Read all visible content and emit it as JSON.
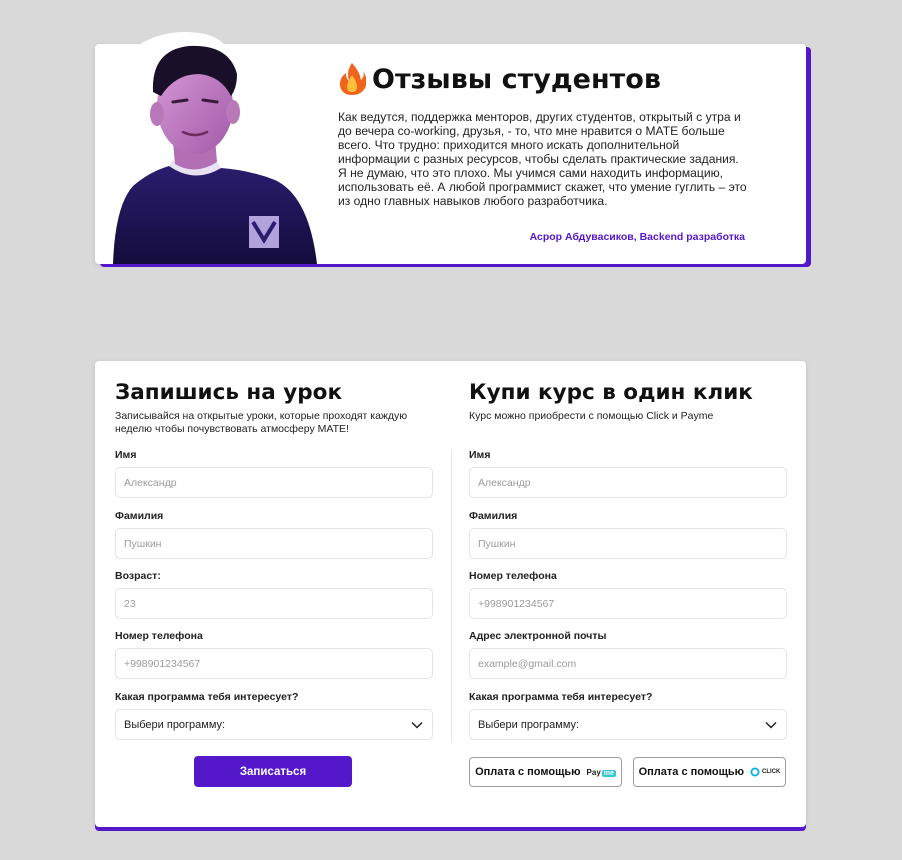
{
  "review": {
    "title": "Отзывы студентов",
    "text": "Как ведутся, поддержка менторов, других студентов, открытый с утра и до вечера co-working, друзья, - то, что мне нравится о MATE больше всего. Что трудно: приходится много искать дополнительной информации с разных ресурсов, чтобы сделать практические задания. Я не думаю, что это плохо. Мы учимся сами находить информацию, использовать её. А любой программист скажет, что умение гуглить – это из одно главных навыков любого разработчика.",
    "author": "Асрор Абдувасиков, Backend разработка",
    "emoji_icon": "fire-icon"
  },
  "lesson_form": {
    "title": "Запишись на урок",
    "subtitle": "Записывайся на открытые уроки, которые проходят каждую неделю чтобы почувствовать атмосферу MATE!",
    "fields": [
      {
        "label": "Имя",
        "placeholder": "Александр"
      },
      {
        "label": "Фамилия",
        "placeholder": "Пушкин"
      },
      {
        "label": "Возраст:",
        "placeholder": "23"
      },
      {
        "label": "Номер телефона",
        "placeholder": "+998901234567"
      },
      {
        "label": "Какая программа тебя интересует?",
        "value": "Выбери программу:"
      }
    ],
    "submit_label": "Записаться"
  },
  "buy_form": {
    "title": "Купи курс в один клик",
    "subtitle": "Курс можно приобрести с помощью Click и Payme",
    "fields": [
      {
        "label": "Имя",
        "placeholder": "Александр"
      },
      {
        "label": "Фамилия",
        "placeholder": "Пушкин"
      },
      {
        "label": "Номер телефона",
        "placeholder": "+998901234567"
      },
      {
        "label": "Адрес электронной почты",
        "placeholder": "example@gmail.com"
      },
      {
        "label": "Какая программа тебя интересует?",
        "value": "Выбери программу:"
      }
    ],
    "payme_label": "Оплата с помощью",
    "payme_logo": {
      "pay": "Pay",
      "me": "me"
    },
    "click_label": "Оплата с помощью",
    "click_logo": "CLICK"
  },
  "colors": {
    "accent": "#5417c9",
    "background": "#d9d9d9",
    "payme_teal": "#35c6cf",
    "click_blue": "#00b2e6"
  }
}
